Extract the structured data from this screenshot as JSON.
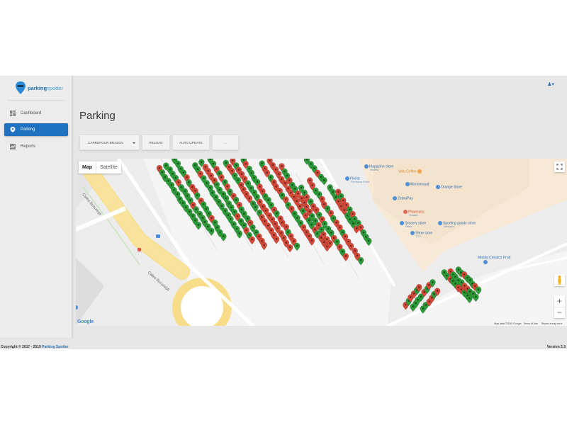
{
  "app": {
    "logo_main": "parking",
    "logo_accent": "spotter"
  },
  "sidebar": {
    "items": [
      {
        "label": "Dashboard",
        "icon": "dashboard-icon",
        "active": false
      },
      {
        "label": "Parking",
        "icon": "map-pin-icon",
        "active": true
      },
      {
        "label": "Reports",
        "icon": "chart-icon",
        "active": false
      }
    ]
  },
  "header": {
    "user_icon": "user-icon",
    "user_caret": "▾"
  },
  "main": {
    "title": "Parking",
    "toolbar": {
      "location_select": "CARREFOUR BRASOV",
      "reload_label": "RELOAD",
      "auto_update_label": "AUTO UPDATE",
      "more_label": "..."
    }
  },
  "map": {
    "type_map": "Map",
    "type_satellite": "Satellite",
    "zoom_in": "+",
    "zoom_out": "−",
    "fullscreen_icon": "fullscreen-icon",
    "pegman_icon": "pegman-icon",
    "road_label_1": "Calea Bucureşti",
    "road_label_2": "Calea Bucureşti",
    "pois": [
      {
        "name": "Magazine store",
        "sub": "Vestelia",
        "color": "blue"
      },
      {
        "name": "Volo Coffee",
        "sub": "",
        "color": "orange"
      },
      {
        "name": "Florist",
        "sub": "Primavera Florez",
        "color": "blue"
      },
      {
        "name": "Marionnaud",
        "sub": "",
        "color": "blue"
      },
      {
        "name": "Orange Store",
        "sub": "",
        "color": "blue"
      },
      {
        "name": "ZebraPay",
        "sub": "",
        "color": "blue"
      },
      {
        "name": "Pharmacy",
        "sub": "Tentalfio",
        "color": "red"
      },
      {
        "name": "Grocery store",
        "sub": "Rebin",
        "color": "blue"
      },
      {
        "name": "Sporting goods store",
        "sub": "Intersport",
        "color": "blue"
      },
      {
        "name": "Shoe store",
        "sub": "CCC",
        "color": "blue"
      },
      {
        "name": "Mobila Conalcn Prod",
        "sub": "",
        "color": "blue"
      }
    ],
    "google_logo": "Google",
    "attribution": "Map data ©2019 Google",
    "terms": "Terms of Use",
    "report": "Report a map error",
    "colors": {
      "free_spot": "#2e9c3a",
      "occupied_spot": "#d64a3a"
    }
  },
  "footer": {
    "copyright_prefix": "Copyright © 2017 - 2019 ",
    "brand": "Parking Spotter",
    "version": "Version 2.3"
  }
}
